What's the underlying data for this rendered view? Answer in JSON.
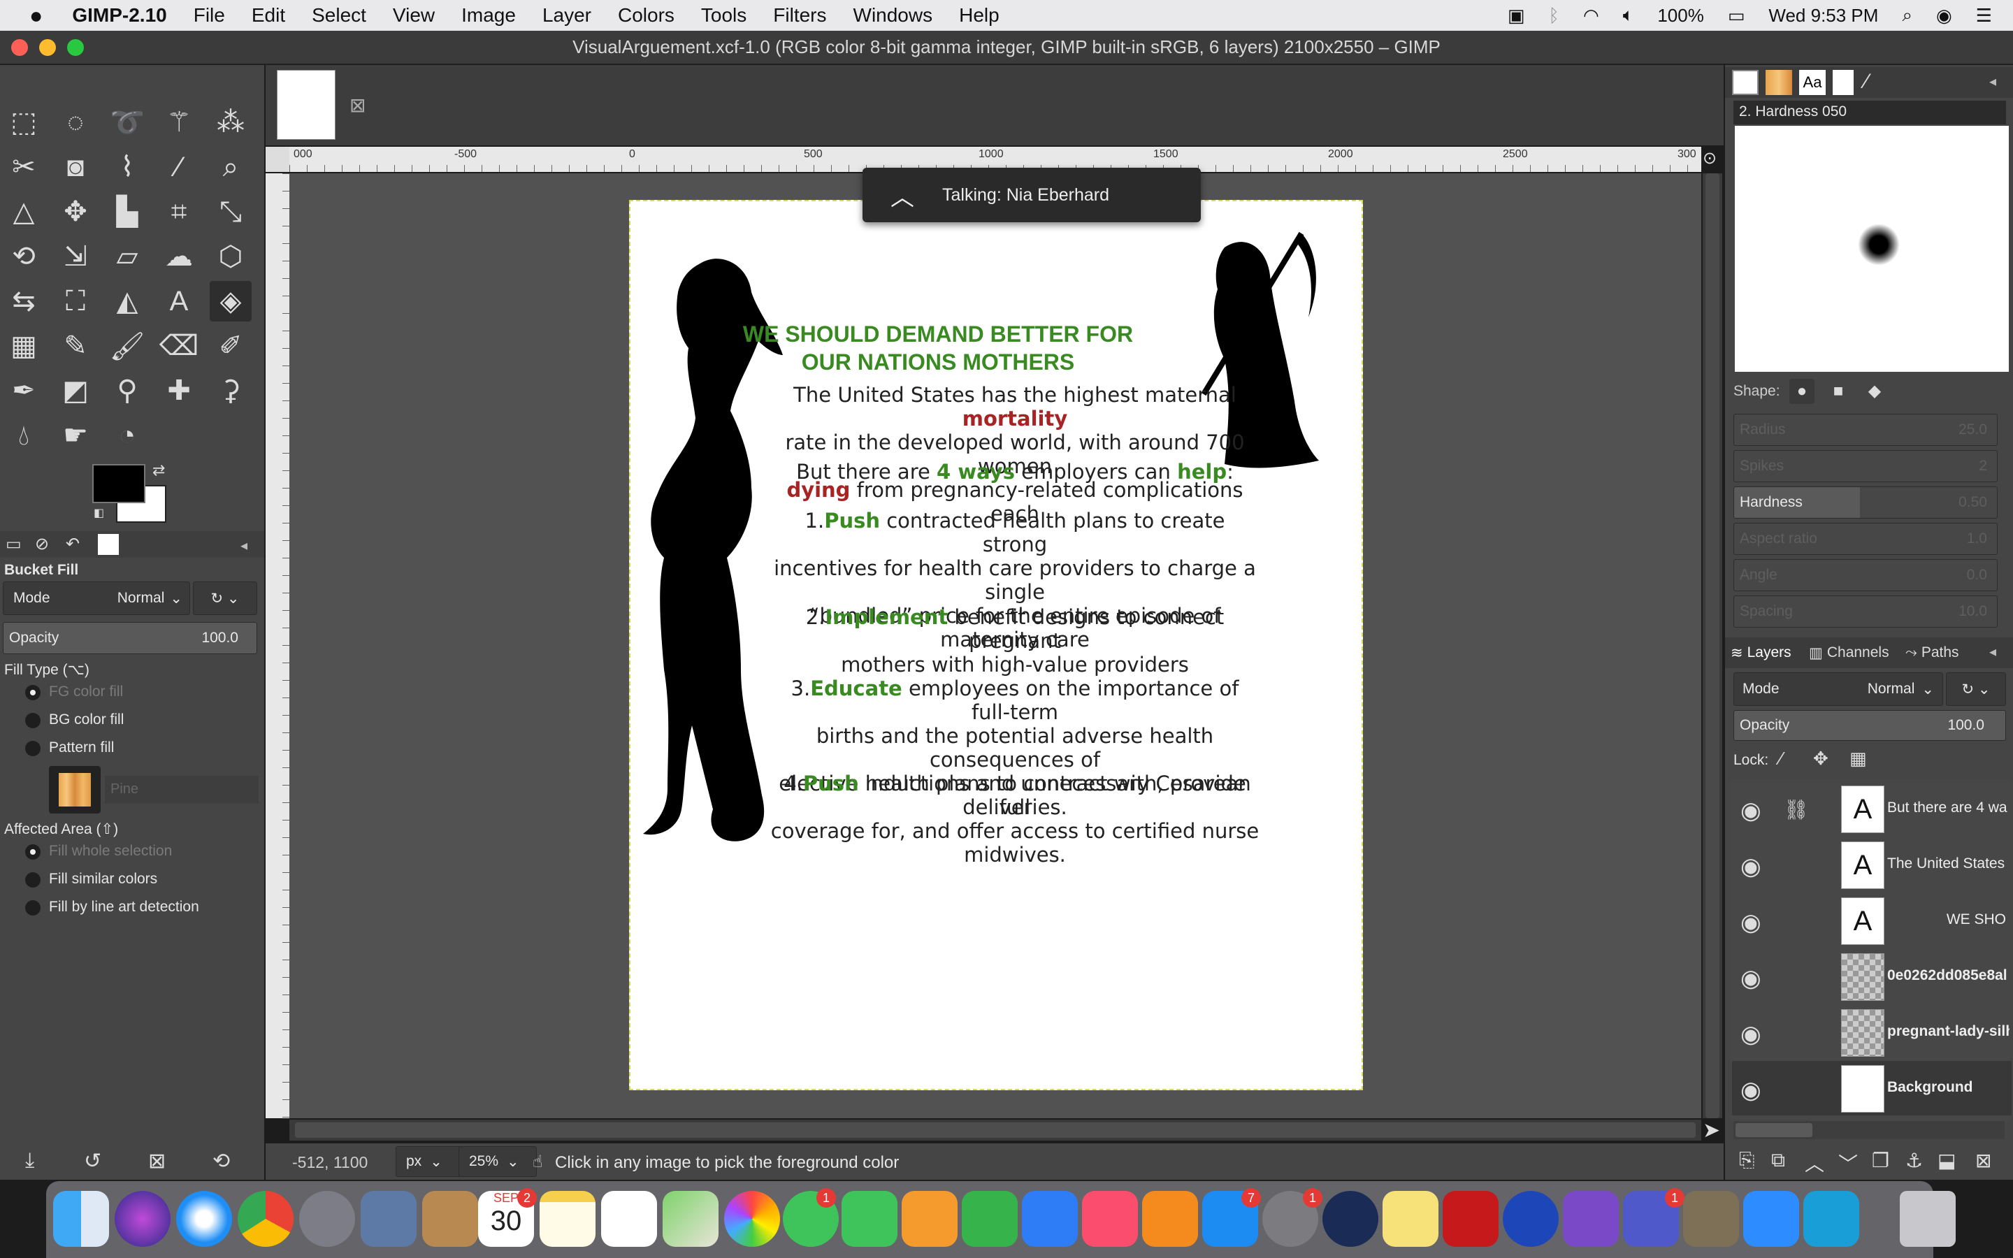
{
  "menubar": {
    "app_name": "GIMP-2.10",
    "items": [
      "File",
      "Edit",
      "Select",
      "View",
      "Image",
      "Layer",
      "Colors",
      "Tools",
      "Filters",
      "Windows",
      "Help"
    ],
    "battery": "100%",
    "clock": "Wed 9:53 PM"
  },
  "window": {
    "title": "VisualArguement.xcf-1.0 (RGB color 8-bit gamma integer, GIMP built-in sRGB, 6 layers) 2100x2550 – GIMP"
  },
  "notification": {
    "text": "Talking: Nia Eberhard"
  },
  "toolbox": {
    "tool_name": "Bucket Fill",
    "mode_label": "Mode",
    "mode_value": "Normal",
    "opacity_label": "Opacity",
    "opacity_value": "100.0",
    "fill_type_label": "Fill Type  (⌥)",
    "fill_options": [
      "FG color fill",
      "BG color fill",
      "Pattern fill"
    ],
    "pattern_name": "Pine",
    "affected_label": "Affected Area  (⇧)",
    "affected_options": [
      "Fill whole selection",
      "Fill similar colors",
      "Fill by line art detection"
    ]
  },
  "ruler": {
    "ticks": [
      "000",
      "-500",
      "0",
      "500",
      "1000",
      "1500",
      "2000",
      "2500",
      "300"
    ]
  },
  "document": {
    "headline1": "WE SHOULD DEMAND BETTER FOR",
    "headline2": "OUR NATIONS MOTHERS",
    "para1": {
      "a": "The United States has the highest maternal ",
      "b": "mortality",
      "c": "rate in the developed world, with around 700 women",
      "d": "dying",
      "e": " from pregnancy-related complications each"
    },
    "ways": {
      "a": "But there are ",
      "b": "4 ways",
      "c": " employers can ",
      "d": "help",
      "e": ":"
    },
    "item1": {
      "num": "1.",
      "kw": "Push",
      "l1": " contracted health plans to create strong",
      "l2": "incentives for health care providers to charge a single",
      "l3": "“bundled” price for the entire episode of maternity care",
      "l4": "."
    },
    "item2": {
      "num": "2.",
      "kw": "Implement",
      "l1": " benefit designs to connect pregnant",
      "l2": "mothers with high-value providers"
    },
    "item3": {
      "num": "3.",
      "kw": "Educate",
      "l1": " employees on the importance of full-term",
      "l2": "births and the potential adverse health consequences of",
      "l3": "elective inductions and unnecessary Cesarean deliveries."
    },
    "item4": {
      "num": "4.",
      "kw": "Push",
      "l1": " health plans to contract with, provide full",
      "l2": "coverage for, and offer access to certified nurse",
      "l3": "midwives."
    }
  },
  "statusbar": {
    "coords": "-512, 1100",
    "unit": "px",
    "zoom": "25%",
    "message": "Click in any image to pick the foreground color"
  },
  "brushes": {
    "brush_name": "2. Hardness 050",
    "shape_label": "Shape:",
    "params": [
      {
        "label": "Radius",
        "value": "25.0"
      },
      {
        "label": "Spikes",
        "value": "2"
      },
      {
        "label": "Hardness",
        "value": "0.50"
      },
      {
        "label": "Aspect ratio",
        "value": "1.0"
      },
      {
        "label": "Angle",
        "value": "0.0"
      },
      {
        "label": "Spacing",
        "value": "10.0"
      }
    ]
  },
  "layers_panel": {
    "tabs": [
      "Layers",
      "Channels",
      "Paths"
    ],
    "mode_label": "Mode",
    "mode_value": "Normal",
    "opacity_label": "Opacity",
    "opacity_value": "100.0",
    "lock_label": "Lock:",
    "layers": [
      {
        "name": "But there are 4 wa",
        "kind": "text"
      },
      {
        "name": "The United States",
        "kind": "text"
      },
      {
        "name": "WE SHO",
        "kind": "text"
      },
      {
        "name": "0e0262dd085e8al",
        "kind": "image"
      },
      {
        "name": "pregnant-lady-silh",
        "kind": "image"
      },
      {
        "name": "Background",
        "kind": "white"
      }
    ]
  },
  "dock": {
    "calendar_month": "SEP",
    "calendar_day": "30",
    "badges": {
      "calendar": "2",
      "messages": "1",
      "appstore": "7",
      "prefs": "1",
      "teams": "1"
    }
  }
}
